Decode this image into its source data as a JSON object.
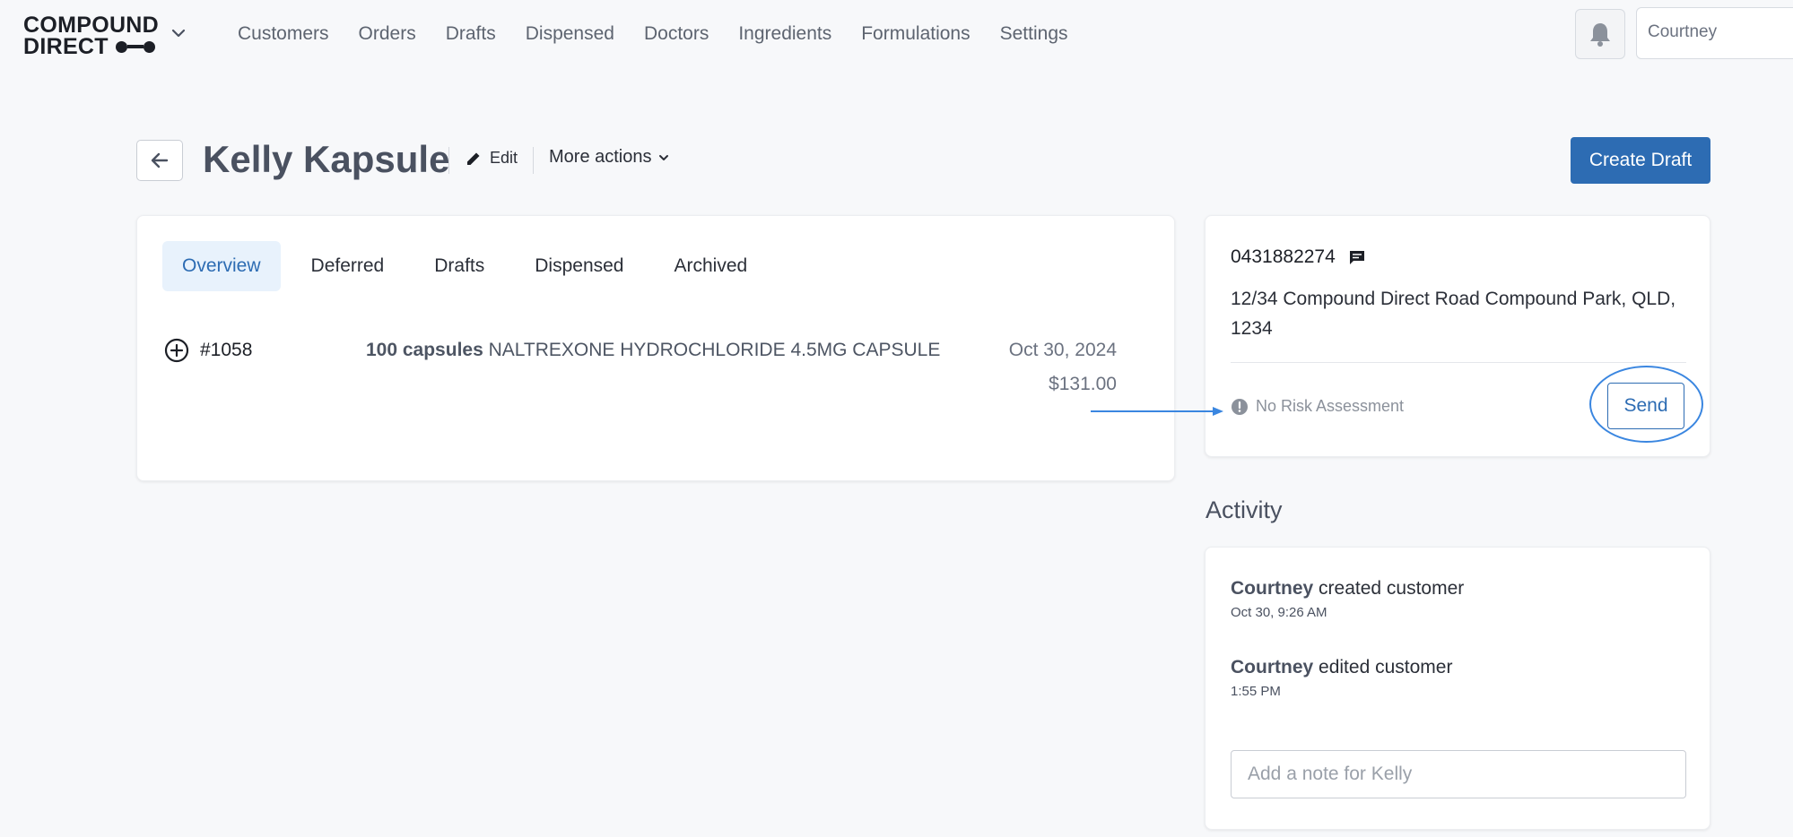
{
  "brand": {
    "line1": "COMPOUND",
    "line2": "DIRECT"
  },
  "nav": {
    "links": [
      "Customers",
      "Orders",
      "Drafts",
      "Dispensed",
      "Doctors",
      "Ingredients",
      "Formulations",
      "Settings"
    ],
    "user": "Courtney"
  },
  "header": {
    "title": "Kelly Kapsule",
    "edit_label": "Edit",
    "more_actions_label": "More actions",
    "create_draft_label": "Create Draft"
  },
  "tabs": [
    "Overview",
    "Deferred",
    "Drafts",
    "Dispensed",
    "Archived"
  ],
  "active_tab": "Overview",
  "orders": [
    {
      "number": "#1058",
      "quantity": "100 capsules",
      "product": "NALTREXONE HYDROCHLORIDE 4.5MG CAPSULE",
      "date": "Oct 30, 2024",
      "price": "$131.00"
    }
  ],
  "customer": {
    "phone": "0431882274",
    "address": "12/34 Compound Direct Road Compound Park, QLD, 1234",
    "risk_status": "No Risk Assessment",
    "send_label": "Send"
  },
  "activity": {
    "title": "Activity",
    "items": [
      {
        "actor": "Courtney",
        "action": "created customer",
        "time": "Oct 30, 9:26 AM"
      },
      {
        "actor": "Courtney",
        "action": "edited customer",
        "time": "1:55 PM"
      }
    ],
    "note_placeholder": "Add a note for Kelly"
  },
  "colors": {
    "primary": "#2d6cb3",
    "active_tab_bg": "#e8f2fc",
    "annotation": "#3a86e0"
  }
}
